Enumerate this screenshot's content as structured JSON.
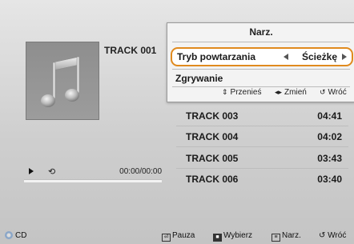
{
  "player": {
    "track_title": "TRACK 001",
    "time": "00:00/00:00",
    "progress_fraction": 0.0
  },
  "tracks": [
    {
      "name": "TRACK 003",
      "duration": "04:41"
    },
    {
      "name": "TRACK 004",
      "duration": "04:02"
    },
    {
      "name": "TRACK 005",
      "duration": "03:43"
    },
    {
      "name": "TRACK 006",
      "duration": "03:40"
    }
  ],
  "popup": {
    "title": "Narz.",
    "option_label": "Tryb powtarzania",
    "option_value": "Ścieżkę",
    "item": "Zgrywanie",
    "hints": {
      "move": "Przenieś",
      "change": "Zmień",
      "back": "Wróć"
    }
  },
  "bottom_bar": {
    "source": "CD",
    "pause": "Pauza",
    "select": "Wybierz",
    "tools": "Narz.",
    "back": "Wróć"
  },
  "colors": {
    "highlight_border": "#e08a1e",
    "background_top": "#e6e6e6",
    "background_bottom": "#c4c4c4"
  },
  "icons": [
    "music-note-icon",
    "play-icon",
    "repeat-icon",
    "arrow-left-icon",
    "arrow-right-icon",
    "disc-icon",
    "pause-key-icon",
    "select-key-icon",
    "tools-key-icon",
    "return-icon"
  ]
}
